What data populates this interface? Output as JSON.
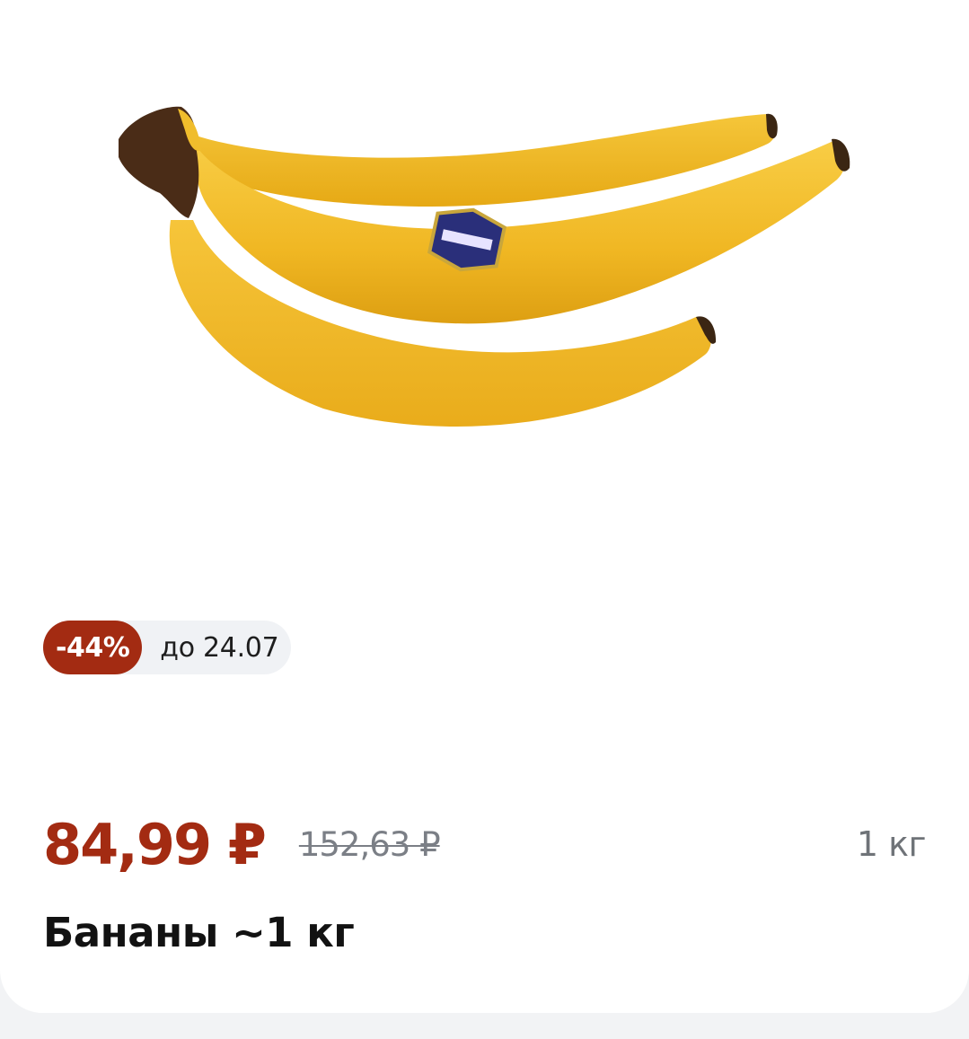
{
  "product": {
    "title": "Бананы ~1 кг",
    "image_icon": "banana-bunch-image"
  },
  "promo": {
    "discount": "-44%",
    "until": "до 24.07"
  },
  "price": {
    "current": "84,99 ₽",
    "old": "152,63 ₽",
    "unit": "1 кг"
  },
  "colors": {
    "accent": "#a32b12",
    "badge_background": "#f0f2f5",
    "page_background": "#f2f3f5"
  }
}
